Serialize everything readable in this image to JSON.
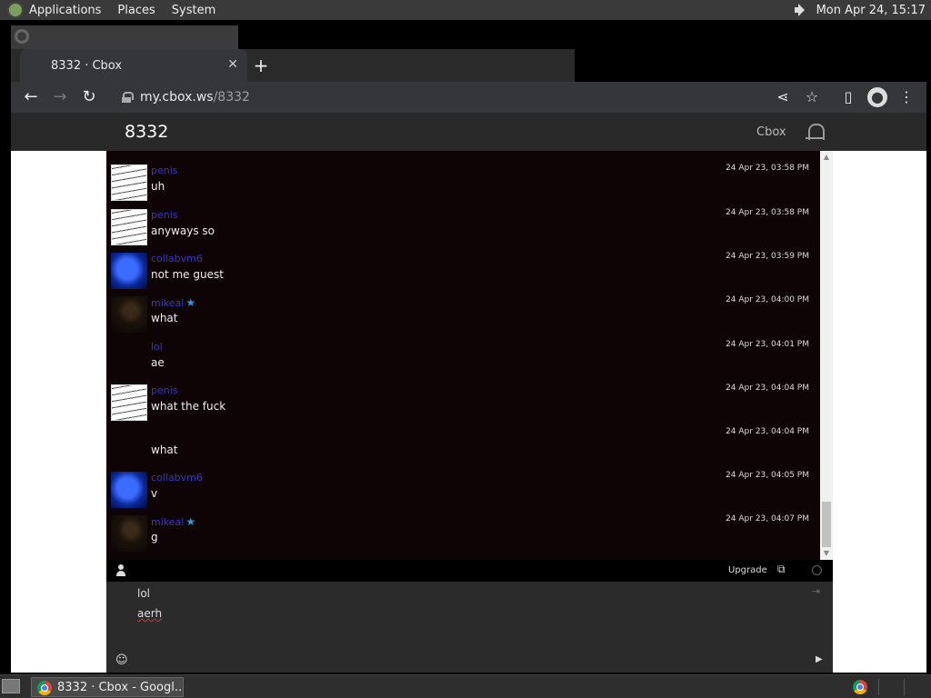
{
  "top_panel": {
    "menus": [
      "Applications",
      "Places",
      "System"
    ],
    "clock": "Mon Apr 24, 15:17"
  },
  "browser": {
    "tab_title": "8332 · Cbox",
    "url_host": "my.cbox.ws",
    "url_path": "/8332"
  },
  "site": {
    "title": "8332",
    "brand": "Cbox"
  },
  "messages": [
    {
      "avatar": "scribble",
      "user": "penis",
      "mod": false,
      "text": "uh",
      "time": "24 Apr 23, 03:58 PM"
    },
    {
      "avatar": "scribble",
      "user": "penis",
      "mod": false,
      "text": "anyways so",
      "time": "24 Apr 23, 03:58 PM"
    },
    {
      "avatar": "blue",
      "user": "collabvm6",
      "mod": false,
      "text": "not me guest",
      "time": "24 Apr 23, 03:59 PM"
    },
    {
      "avatar": "dark",
      "user": "mikeal",
      "mod": true,
      "text": "what",
      "time": "24 Apr 23, 04:00 PM"
    },
    {
      "avatar": "none",
      "user": "lol",
      "mod": false,
      "text": "ae",
      "time": "24 Apr 23, 04:01 PM"
    },
    {
      "avatar": "scribble",
      "user": "penis",
      "mod": false,
      "text": "what the fuck",
      "time": "24 Apr 23, 04:04 PM"
    },
    {
      "avatar": "none",
      "user": "",
      "mod": false,
      "text": "what",
      "time": "24 Apr 23, 04:04 PM"
    },
    {
      "avatar": "blue",
      "user": "collabvm6",
      "mod": false,
      "text": "v",
      "time": "24 Apr 23, 04:05 PM"
    },
    {
      "avatar": "dark",
      "user": "mikeal",
      "mod": true,
      "text": "g",
      "time": "24 Apr 23, 04:07 PM"
    }
  ],
  "chat_toolbar": {
    "upgrade_label": "Upgrade"
  },
  "compose": {
    "name_value": "lol",
    "message_value": "aerh"
  },
  "taskbar": {
    "window_label": "8332 · Cbox - Googl..."
  }
}
